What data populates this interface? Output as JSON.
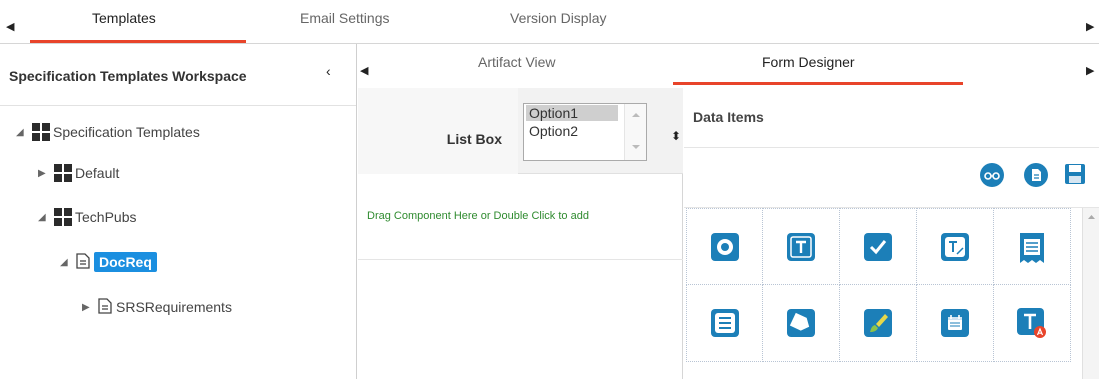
{
  "top_tabs": {
    "tabs": [
      {
        "label": "Templates",
        "active": true
      },
      {
        "label": "Email Settings",
        "active": false
      },
      {
        "label": "Version Display",
        "active": false
      }
    ]
  },
  "left_panel": {
    "title": "Specification Templates Workspace",
    "tree": [
      {
        "label": "Specification Templates",
        "icon": "grid-icon",
        "expanded": true
      },
      {
        "label": "Default",
        "icon": "grid-icon",
        "expanded": false
      },
      {
        "label": "TechPubs",
        "icon": "grid-icon",
        "expanded": true
      },
      {
        "label": "DocReq",
        "icon": "document-icon",
        "expanded": true,
        "selected": true
      },
      {
        "label": "SRSRequirements",
        "icon": "document-icon",
        "expanded": false
      }
    ]
  },
  "middle_tabs": {
    "tabs": [
      {
        "label": "Artifact View",
        "active": false
      },
      {
        "label": "Form Designer",
        "active": true
      }
    ]
  },
  "form_canvas": {
    "list_box_label": "List Box",
    "list_box_options": [
      "Option1",
      "Option2"
    ],
    "list_box_selected": "Option1",
    "drop_hint": "Drag Component Here or Double Click to add"
  },
  "data_items": {
    "title": "Data Items",
    "toolbar_icons": [
      "glasses-preview-icon",
      "document-icon",
      "save-icon"
    ],
    "components": [
      "radio-button-icon",
      "text-field-icon",
      "checkbox-icon",
      "rich-text-icon",
      "text-area-icon",
      "list-box-icon",
      "tag-icon",
      "color-picker-icon",
      "calendar-icon",
      "text-label-icon"
    ]
  },
  "colors": {
    "accent_underline": "#e8442a",
    "selected_node": "#1b8fe0",
    "component_tile": "#1c7fb8",
    "drop_hint_text": "#2f8b2f"
  }
}
